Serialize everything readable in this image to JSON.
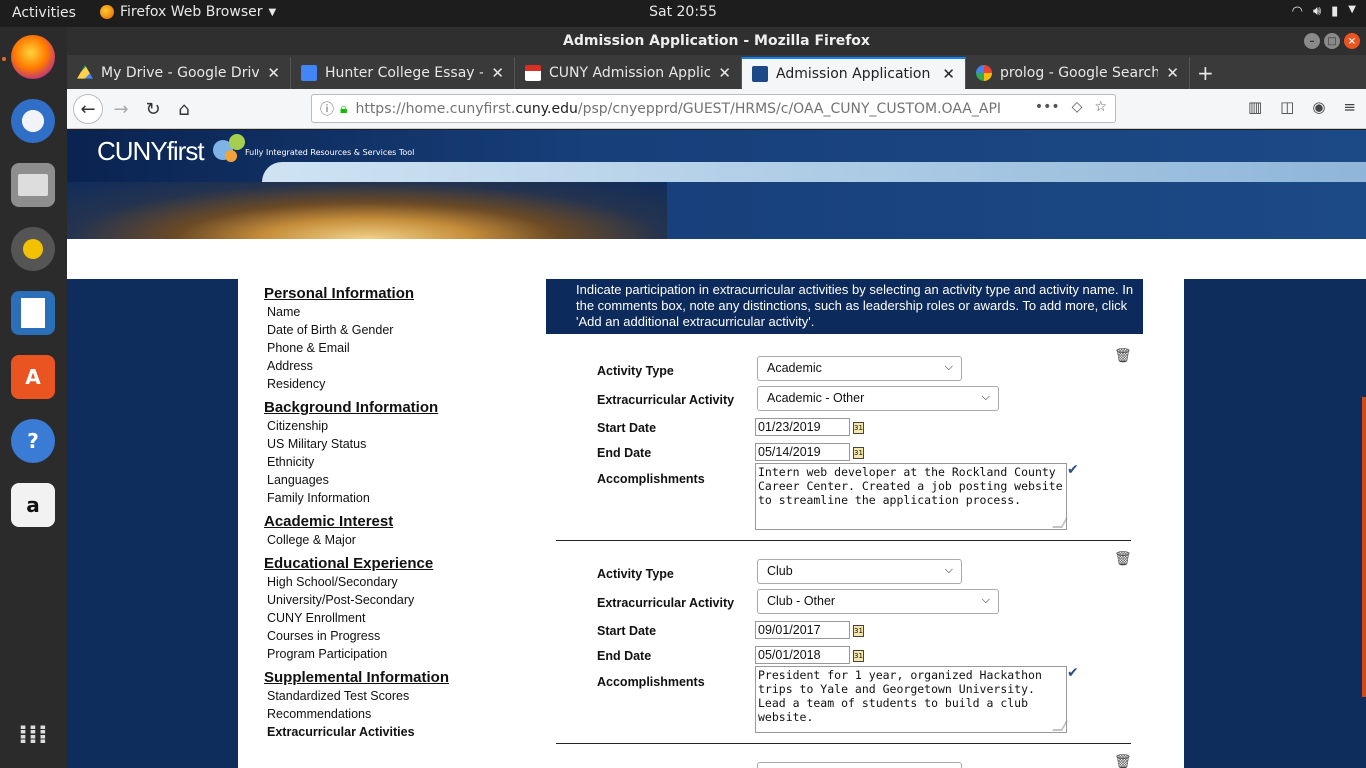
{
  "topbar": {
    "activities": "Activities",
    "app_name": "Firefox Web Browser",
    "clock": "Sat 20:55"
  },
  "window": {
    "title": "Admission Application - Mozilla Firefox"
  },
  "tabs": [
    {
      "label": "My Drive - Google Drive",
      "color": "#1fa463"
    },
    {
      "label": "Hunter College Essay - Go",
      "color": "#4285f4"
    },
    {
      "label": "CUNY Admission Applica",
      "color": "#d93025"
    },
    {
      "label": "Admission Application",
      "color": "#1c4a86"
    },
    {
      "label": "prolog - Google Search",
      "color": "#ea4335"
    }
  ],
  "navbar": {
    "url_prefix": "https://home.cunyfirst.",
    "url_domain": "cuny.edu",
    "url_path": "/psp/cnyepprd/GUEST/HRMS/c/OAA_CUNY_CUSTOM.OAA_API"
  },
  "banner": {
    "logo_cuny": "CUNY",
    "logo_first": "first",
    "tagline": "Fully Integrated Resources & Services Tool"
  },
  "nav": {
    "sections": [
      {
        "title": "Personal Information",
        "items": [
          "Name",
          "Date of Birth & Gender",
          "Phone & Email",
          "Address",
          "Residency"
        ]
      },
      {
        "title": "Background Information",
        "items": [
          "Citizenship",
          "US Military Status",
          "Ethnicity",
          "Languages",
          "Family Information"
        ]
      },
      {
        "title": "Academic Interest",
        "items": [
          "College & Major"
        ]
      },
      {
        "title": "Educational Experience",
        "items": [
          "High School/Secondary",
          "University/Post-Secondary",
          "CUNY Enrollment",
          "Courses in Progress",
          "Program Participation"
        ]
      },
      {
        "title": "Supplemental Information",
        "items": [
          "Standardized Test Scores",
          "Recommendations",
          "Extracurricular Activities"
        ]
      }
    ]
  },
  "content": {
    "intro": "Indicate participation in extracurricular activities by selecting an activity type and activity name. In the comments box, note any distinctions, such as leadership roles or awards. To add more, click 'Add an additional extracurricular activity'.",
    "labels": {
      "activity_type": "Activity Type",
      "extracurricular": "Extracurricular Activity",
      "start_date": "Start Date",
      "end_date": "End Date",
      "accomplishments": "Accomplishments"
    },
    "entries": [
      {
        "activity_type": "Academic",
        "activity": "Academic - Other",
        "start_date": "01/23/2019",
        "end_date": "05/14/2019",
        "accomplishments": "Intern web developer at the Rockland County Career Center. Created a job posting website to streamline the application process."
      },
      {
        "activity_type": "Club",
        "activity": "Club - Other",
        "start_date": "09/01/2017",
        "end_date": "05/01/2018",
        "accomplishments": "President for 1 year, organized Hackathon trips to Yale and Georgetown University. Lead a team of students to build a club website."
      }
    ]
  },
  "icons": {
    "calendar": "31"
  }
}
